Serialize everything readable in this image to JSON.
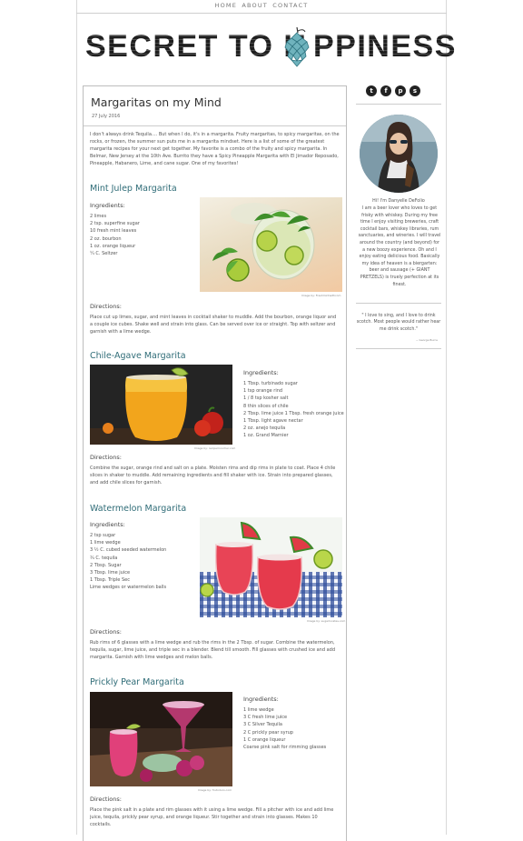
{
  "nav": {
    "links": [
      "HOME",
      "ABOUT",
      "CONTACT"
    ]
  },
  "logo": {
    "left": "SECRET TO H",
    "right": "PPINESS"
  },
  "post": {
    "title": "Margaritas on my Mind",
    "date": "27 July 2016",
    "intro": "I don't always drink Tequila.... But when I do, it's in a margarita. Fruity margaritas, to spicy margaritas, on the rocks, or frozen, the summer sun puts me in a margarita mindset. Here is a list of some of the greatest margarita recipes for your next get together. My favorite is a combo of the fruity and spicy margarita. In Belmar, New Jersey at the 10th Ave. Burrito they have a Spicy Pineapple Margarita with El Jimador Reposado, Pineapple, Habanero, Lime, and cane sugar. One of my favorites!",
    "recipes": [
      {
        "title": "Mint Julep Margarita",
        "ingredients_label": "Ingredients:",
        "ingredients": [
          "2 limes",
          "2 tsp. superfine sugar",
          "10 fresh mint leaves",
          "2 oz. bourbon",
          "1 oz. orange liqueur",
          "¼ C. Seltzer"
        ],
        "credit": "Image by: Freshmintwithcom",
        "directions_label": "Directions:",
        "directions": "Place cut up limes, sugar, and mint leaves in cocktail shaker to muddle. Add the bourbon, orange liquor and a couple ice cubes. Shake well and strain into glass. Can be served over ice or straight. Top with seltzer and garnish with a lime wedge."
      },
      {
        "title": "Chile-Agave Margarita",
        "ingredients_label": "Ingredients:",
        "ingredients": [
          "1 Tbsp. turbinado sugar",
          "1 tsp orange rind",
          "1 / 8 tsp kosher salt",
          "8 thin slices of chile",
          "2 Tbsp. lime juice 1 Tbsp. fresh orange juice",
          "1 Tbsp. light agave nectar",
          "2 oz. anejo tequila",
          "1 oz. Grand Marnier"
        ],
        "credit": "Image by: recipemoocher.com",
        "directions_label": "Directions:",
        "directions": "Combine the sugar, orange rind and salt on a plate. Moisten rims and dip rims in plate to coat. Place 4 chile slices in shaker to muddle. Add remaining ingredients and fill shaker with ice. Strain into prepared glasses, and add chile slices for garnish."
      },
      {
        "title": "Watermelon Margarita",
        "ingredients_label": "Ingredients:",
        "ingredients": [
          "2 tsp sugar",
          "1 lime wedge",
          "3 ½ C. cubed seeded watermelon",
          "¾ C. tequila",
          "2 Tbsp. Sugar",
          "3 Tbsp. lime juice",
          "1 Tbsp. Triple Sec",
          "Lime wedges or watermelon balls"
        ],
        "credit": "Image by: sugarlocates.com",
        "directions_label": "Directions:",
        "directions": "Rub rims of 6 glasses with a lime wedge and rub the rims in the 2 Tbsp. of sugar. Combine the watermelon, tequila, sugar, lime juice, and triple sec in a blender. Blend till smooth. Fill glasses with crushed ice and add margarita. Garnish with lime wedges and melon balls."
      },
      {
        "title": "Prickly Pear Margarita",
        "ingredients_label": "Ingredients:",
        "ingredients": [
          "1 lime wedge",
          "3 C fresh lime juice",
          "3 C Silver Tequila",
          "2 C prickly pear syrup",
          "1 C orange liqueur",
          "Coarse pink salt for rimming glasses"
        ],
        "credit": "Image by: frutoduro.com",
        "directions_label": "Directions:",
        "directions": "Place the pink salt in a plate and rim glasses with it using a lime wedge. Fill a pitcher with ice and add lime juice, tequila, prickly pear syrup, and orange liqueur. Stir together and strain into glasses. Makes 10 cocktails."
      }
    ]
  },
  "sidebar": {
    "social": [
      {
        "icon": "twitter-icon",
        "glyph": "t"
      },
      {
        "icon": "facebook-icon",
        "glyph": "f"
      },
      {
        "icon": "pinterest-icon",
        "glyph": "p"
      },
      {
        "icon": "snapchat-icon",
        "glyph": "s"
      }
    ],
    "greeting": "Hi! I'm Danyelle DeFolio",
    "bio": "I am a beer lover who loves to get frisky with whiskey. During my free time I enjoy visiting breweries, craft cocktail bars, whiskey libraries, rum sanctuaries, and wineries. I will travel around the country (and beyond) for a new boozy experience. Oh and I enjoy eating delicious food. Basically my idea of heaven is a biergarten: beer and sausage (+ GIANT PRETZELS) is truely perfection at its finest.",
    "quote": "\" I love to sing, and I love to drink scotch. Most people would rather hear me drink scotch.\"",
    "quote_attr": "~ George Burns"
  },
  "colors": {
    "heading": "#2f6c77",
    "hop": "#6fb3bd"
  }
}
